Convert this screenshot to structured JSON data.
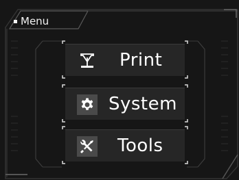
{
  "header": {
    "title": "Menu"
  },
  "menu": {
    "items": [
      {
        "label": "Print",
        "icon": "print-icon"
      },
      {
        "label": "System",
        "icon": "gear-icon"
      },
      {
        "label": "Tools",
        "icon": "tools-icon"
      }
    ]
  },
  "colors": {
    "background": "#161616",
    "button": "#262626",
    "icon_box": "#4a4a4a",
    "text": "#ffffff",
    "frame_line": "#3c3c3c"
  }
}
